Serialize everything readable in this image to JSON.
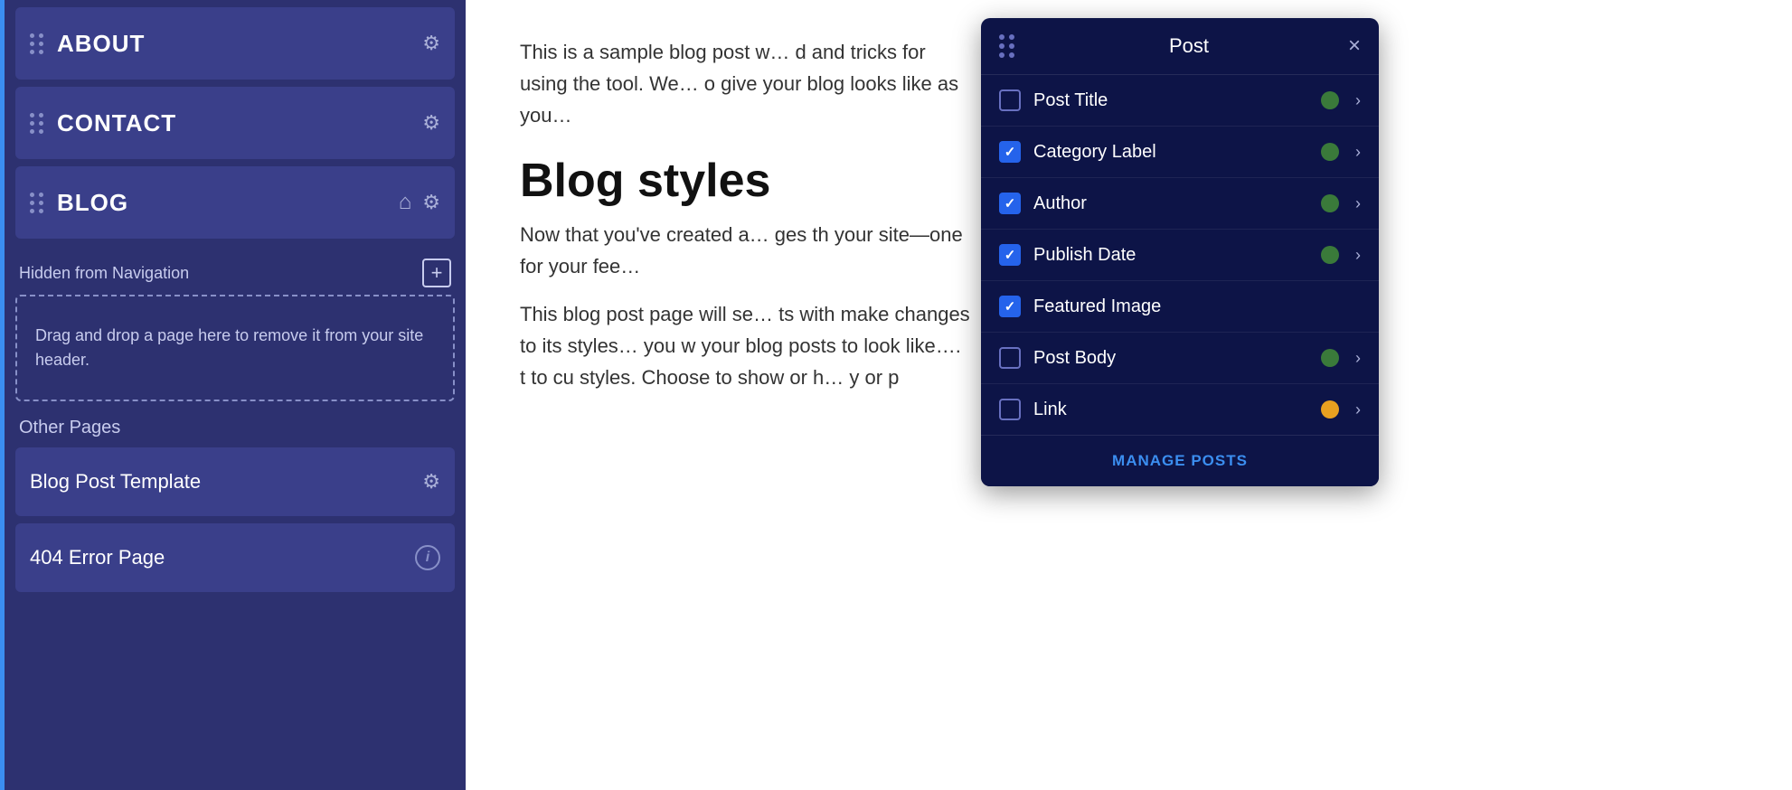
{
  "sidebar": {
    "nav_items": [
      {
        "id": "about",
        "label": "ABOUT",
        "hasHome": false,
        "hasGear": true
      },
      {
        "id": "contact",
        "label": "CONTACT",
        "hasHome": false,
        "hasGear": true
      },
      {
        "id": "blog",
        "label": "BLOG",
        "hasHome": true,
        "hasGear": true
      }
    ],
    "hidden_nav": {
      "title": "Hidden from Navigation",
      "add_btn_label": "+",
      "drop_zone_text": "Drag and drop a page here to remove it from your site header."
    },
    "other_pages": {
      "title": "Other Pages",
      "items": [
        {
          "id": "blog-post-template",
          "label": "Blog Post Template",
          "hasGear": true,
          "hasInfo": false
        },
        {
          "id": "404-error-page",
          "label": "404 Error Page",
          "hasGear": false,
          "hasInfo": true
        }
      ]
    }
  },
  "main": {
    "intro_text": "This is a sample blog post w... d and tricks for using the tool. We... o give your blog looks like as you...",
    "heading": "Blog styles",
    "body_text1": "Now that you've created a... ges th your site—one for your fee...",
    "body_text2": "This blog post page will se... ts with make changes to its styles... you w your blog posts to look like.... t to cu styles. Choose to show or h... y or p"
  },
  "post_panel": {
    "title": "Post",
    "close_label": "×",
    "items": [
      {
        "id": "post-title",
        "label": "Post Title",
        "checked": false,
        "status": "green"
      },
      {
        "id": "category-label",
        "label": "Category Label",
        "checked": true,
        "status": "green"
      },
      {
        "id": "author",
        "label": "Author",
        "checked": true,
        "status": "green"
      },
      {
        "id": "publish-date",
        "label": "Publish Date",
        "checked": true,
        "status": "green"
      },
      {
        "id": "featured-image",
        "label": "Featured Image",
        "checked": true,
        "status": null
      },
      {
        "id": "post-body",
        "label": "Post Body",
        "checked": false,
        "status": "green"
      },
      {
        "id": "link",
        "label": "Link",
        "checked": false,
        "status": "yellow"
      }
    ],
    "manage_posts_label": "MANAGE POSTS"
  }
}
